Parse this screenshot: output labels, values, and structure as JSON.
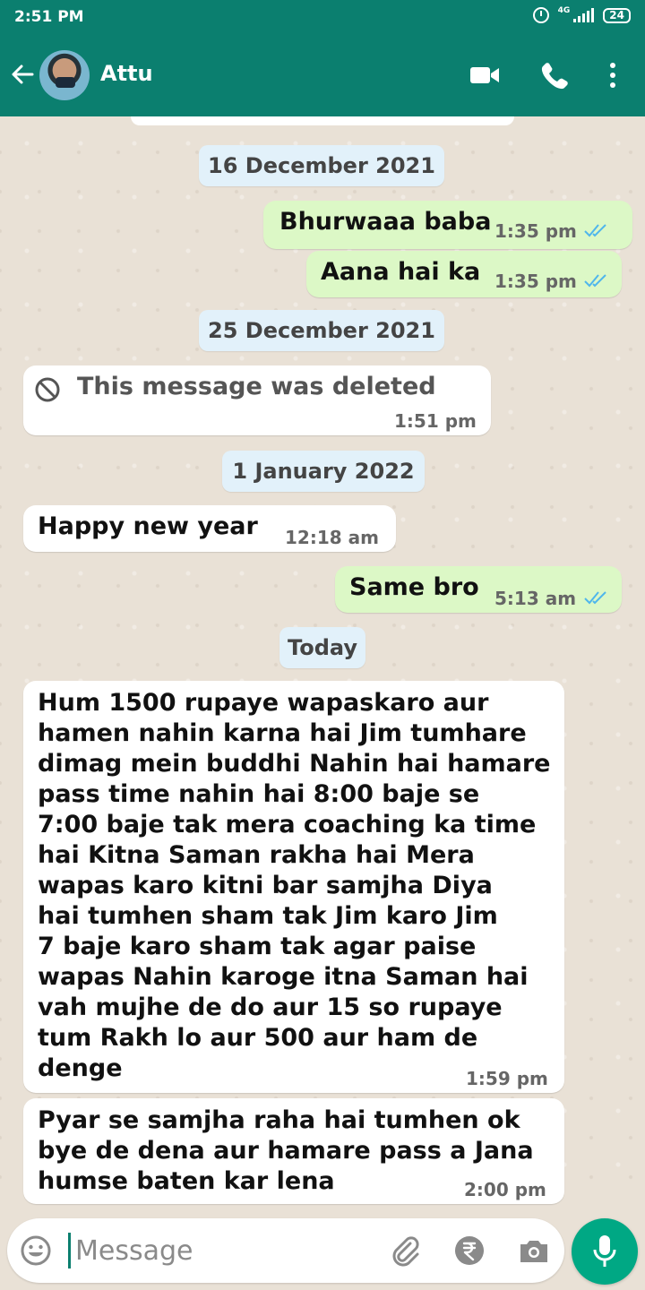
{
  "status_bar": {
    "time": "2:51 PM",
    "network_label": "4G",
    "battery": "24"
  },
  "header": {
    "contact_name": "Attu",
    "icons": [
      "back-arrow-icon",
      "video-call-icon",
      "voice-call-icon",
      "more-options-icon"
    ]
  },
  "chat": {
    "date_16_dec": "16 December 2021",
    "msg_1": {
      "text": "Bhurwaaa baba",
      "time": "1:35 pm",
      "direction": "outgoing",
      "status": "read"
    },
    "msg_2": {
      "text": "Aana hai ka",
      "time": "1:35 pm",
      "direction": "outgoing",
      "status": "read"
    },
    "date_25_dec": "25 December 2021",
    "msg_deleted": {
      "text": "This message was deleted",
      "time": "1:51 pm",
      "direction": "incoming"
    },
    "date_1_jan": "1 January 2022",
    "msg_3": {
      "text": "Happy new year",
      "time": "12:18 am",
      "direction": "incoming"
    },
    "msg_4": {
      "text": "Same bro",
      "time": "5:13 am",
      "direction": "outgoing",
      "status": "read"
    },
    "date_today": "Today",
    "msg_5": {
      "lines": [
        "Hum 1500 rupaye wapaskaro aur",
        "hamen nahin karna hai Jim tumhare",
        "dimag mein buddhi Nahin hai hamare",
        "pass time nahin hai 8:00 baje se",
        "7:00 baje tak mera coaching ka time",
        "hai Kitna Saman rakha hai Mera",
        "wapas karo kitni bar samjha Diya",
        "hai tumhen sham tak Jim karo Jim",
        "7 baje karo sham tak agar paise",
        "wapas Nahin karoge itna Saman hai",
        "vah mujhe de do aur 15 so rupaye",
        "tum Rakh lo aur 500 aur ham de",
        "denge"
      ],
      "time": "1:59 pm",
      "direction": "incoming"
    },
    "msg_6": {
      "lines": [
        "Pyar se samjha raha hai tumhen ok",
        "bye de dena aur hamare pass a Jana",
        "humse baten kar lena"
      ],
      "time": "2:00 pm",
      "direction": "incoming"
    }
  },
  "composer": {
    "placeholder": "Message"
  },
  "colors": {
    "header": "#0b7f6f",
    "outgoing_bubble": "#dcf8c6",
    "incoming_bubble": "#ffffff",
    "read_tick": "#4fb6ec",
    "mic_button": "#00a884"
  }
}
